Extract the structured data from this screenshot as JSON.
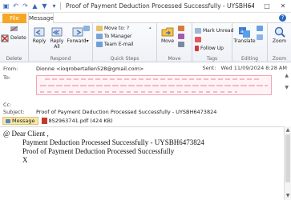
{
  "window": {
    "title": "Proof of Payment Deduction Processed Successfully - UYSBH6473824 - Mess...",
    "controls": [
      "—",
      "□",
      "✕"
    ]
  },
  "tabs": {
    "file": "File",
    "message": "Message",
    "help": "?"
  },
  "ribbon": {
    "delete_group": {
      "label": "Delete",
      "delete": "Delete"
    },
    "respond_group": {
      "label": "Respond",
      "reply": "Reply",
      "reply_all_1": "Reply",
      "reply_all_2": "All",
      "forward": "Forward",
      "forward_caret": "▾"
    },
    "quick_steps": {
      "label": "Quick Steps",
      "move_to": "Move to: ?",
      "to_manager": "To Manager",
      "team_email": "Team E-mail"
    },
    "move_group": {
      "label": "Move",
      "move": "Move"
    },
    "tags_group": {
      "label": "Tags",
      "mark_unread": "Mark Unread",
      "follow_up": "Follow Up"
    },
    "editing_group": {
      "label": "Editing",
      "translate": "Translate"
    },
    "zoom_group": {
      "label": "Zoom",
      "zoom": "Zoom"
    }
  },
  "header": {
    "from_label": "From:",
    "from_value": "Dionne <ioqrobertallen528@gmail.com>",
    "to_label": "To:",
    "sent_label": "Sent:",
    "sent_value": "Wed 11/09/2024 8:28 AM",
    "cc_label": "Cc:",
    "subject_label": "Subject:",
    "subject_value": "Proof of Payment Deduction Processed Successfully - UYSBH6473824"
  },
  "attachments": {
    "message_label": "Message",
    "file": "8S2963741.pdf (424 KB)"
  },
  "body": {
    "greeting": "@ Dear Client ,",
    "line1": "Payment Deduction Processed Successfully - UYSBH6473824",
    "line2": "Proof of Payment Deduction Processed Successfully",
    "line3": "X"
  },
  "colors": {
    "file_tab": "#f5a623",
    "accent": "#2c6bc4",
    "redaction_border": "#f0a4b5"
  }
}
